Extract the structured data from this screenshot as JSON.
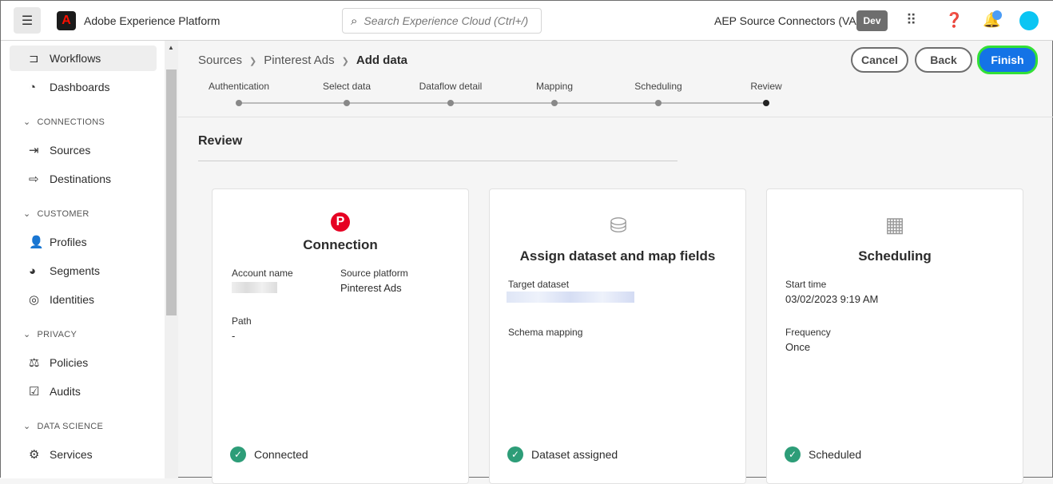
{
  "header": {
    "app_title": "Adobe Experience Platform",
    "search_placeholder": "Search Experience Cloud (Ctrl+/)",
    "org": "AEP Source Connectors (VA7)",
    "env": "Dev"
  },
  "sidebar": {
    "items": [
      {
        "label": "Workflows",
        "icon": "workflow-icon"
      },
      {
        "label": "Dashboards",
        "icon": "dashboard-icon"
      },
      {
        "section": "CONNECTIONS"
      },
      {
        "label": "Sources",
        "icon": "sources-icon"
      },
      {
        "label": "Destinations",
        "icon": "destinations-icon"
      },
      {
        "section": "CUSTOMER"
      },
      {
        "label": "Profiles",
        "icon": "user-icon"
      },
      {
        "label": "Segments",
        "icon": "segments-icon"
      },
      {
        "label": "Identities",
        "icon": "fingerprint-icon"
      },
      {
        "section": "PRIVACY"
      },
      {
        "label": "Policies",
        "icon": "gavel-icon"
      },
      {
        "label": "Audits",
        "icon": "audits-icon"
      },
      {
        "section": "DATA SCIENCE"
      },
      {
        "label": "Services",
        "icon": "services-icon"
      }
    ]
  },
  "breadcrumb": [
    "Sources",
    "Pinterest Ads",
    "Add data"
  ],
  "buttons": {
    "cancel": "Cancel",
    "back": "Back",
    "finish": "Finish"
  },
  "steps": [
    "Authentication",
    "Select data",
    "Dataflow detail",
    "Mapping",
    "Scheduling",
    "Review"
  ],
  "review_title": "Review",
  "cards": {
    "connection": {
      "title": "Connection",
      "account_name_label": "Account name",
      "source_platform_label": "Source platform",
      "source_platform": "Pinterest Ads",
      "path_label": "Path",
      "path": "-",
      "status": "Connected"
    },
    "dataset": {
      "title": "Assign dataset and map fields",
      "target_label": "Target dataset",
      "schema_label": "Schema mapping",
      "status": "Dataset assigned"
    },
    "scheduling": {
      "title": "Scheduling",
      "start_label": "Start time",
      "start": "03/02/2023 9:19 AM",
      "freq_label": "Frequency",
      "freq": "Once",
      "status": "Scheduled"
    }
  }
}
